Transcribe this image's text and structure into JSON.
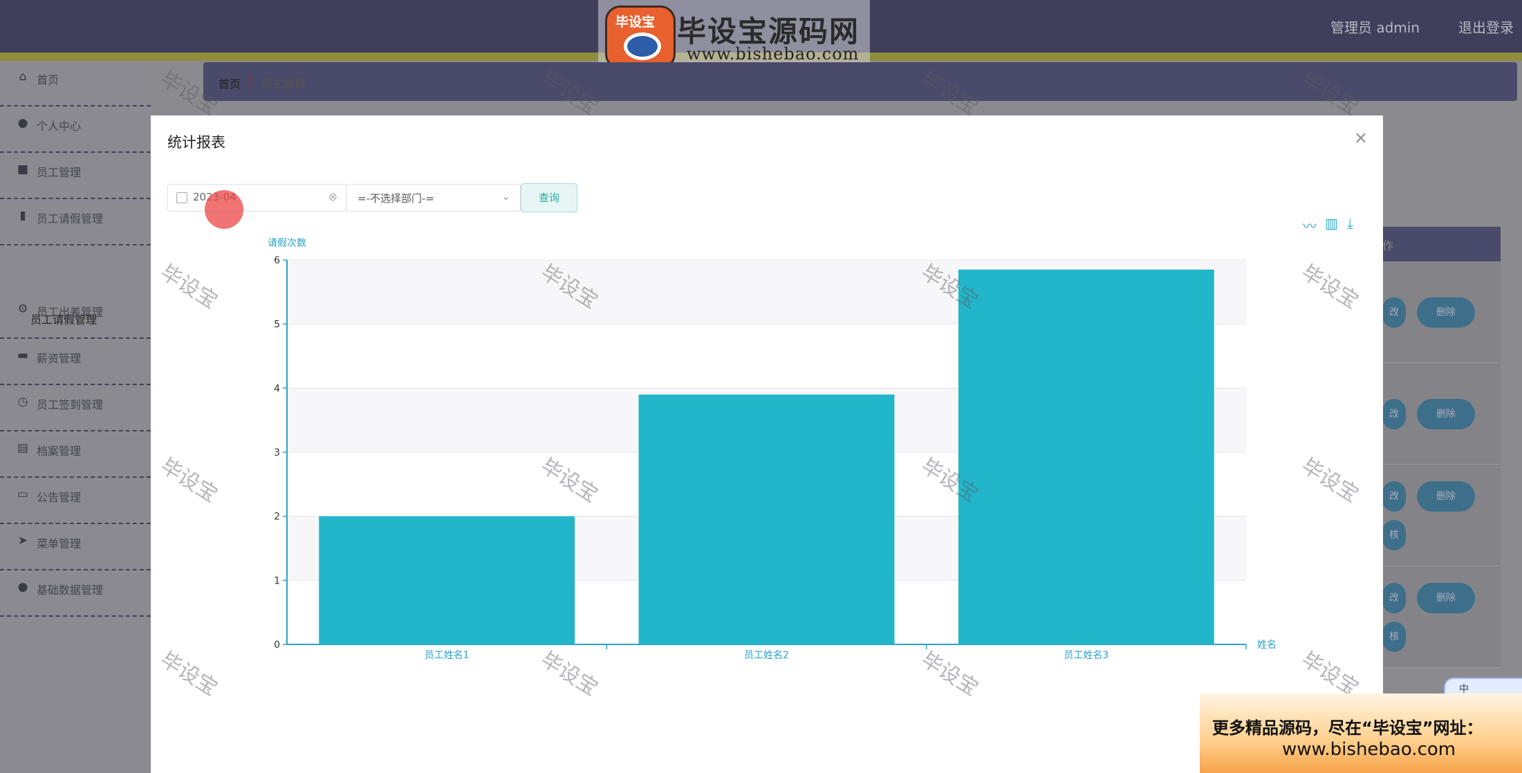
{
  "header": {
    "user_label": "管理员 admin",
    "logout_label": "退出登录"
  },
  "logo": {
    "badge_text": "毕设宝",
    "title": "毕设宝源码网",
    "url": "www.bishebao.com"
  },
  "sidebar": {
    "items": [
      {
        "label": "首页",
        "icon": "home-icon"
      },
      {
        "label": "个人中心",
        "icon": "user-icon"
      },
      {
        "label": "员工管理",
        "icon": "briefcase-icon"
      },
      {
        "label": "员工请假管理",
        "icon": "bar-chart-icon"
      },
      {
        "label": "员工出差管理",
        "icon": "gear-icon"
      },
      {
        "label": "薪资管理",
        "icon": "suitcase-icon"
      },
      {
        "label": "员工签到管理",
        "icon": "clock-icon"
      },
      {
        "label": "档案管理",
        "icon": "clipboard-icon"
      },
      {
        "label": "公告管理",
        "icon": "monitor-icon"
      },
      {
        "label": "菜单管理",
        "icon": "send-icon"
      },
      {
        "label": "基础数据管理",
        "icon": "user-icon"
      }
    ],
    "sub_item": "员工请假管理"
  },
  "breadcrumb": {
    "home": "首页",
    "separator": "/",
    "current": "员工请假"
  },
  "background_table": {
    "header_fragment": "作",
    "edit_fragment": "改",
    "delete_label": "删除",
    "review_fragment": "核"
  },
  "modal": {
    "title": "统计报表",
    "close_glyph": "×",
    "date_value": "2023-04",
    "dept_placeholder": "=-不选择部门-=",
    "query_label": "查询"
  },
  "chart_data": {
    "type": "bar",
    "categories": [
      "员工姓名1",
      "员工姓名2",
      "员工姓名3"
    ],
    "values": [
      2,
      3.9,
      5.85
    ],
    "ylabel": "请假次数",
    "xlabel": "姓名",
    "ylim": [
      0,
      6
    ],
    "yticks": [
      0,
      1,
      2,
      3,
      4,
      5,
      6
    ],
    "bar_color": "#22b6cb",
    "axis_color": "#2aa0c8",
    "grid": true
  },
  "watermark_text": "毕设宝",
  "ad": {
    "line1": "更多精品源码，尽在“毕设宝”网址：",
    "line2": "www.bishebao.com"
  },
  "ime_label": "中"
}
